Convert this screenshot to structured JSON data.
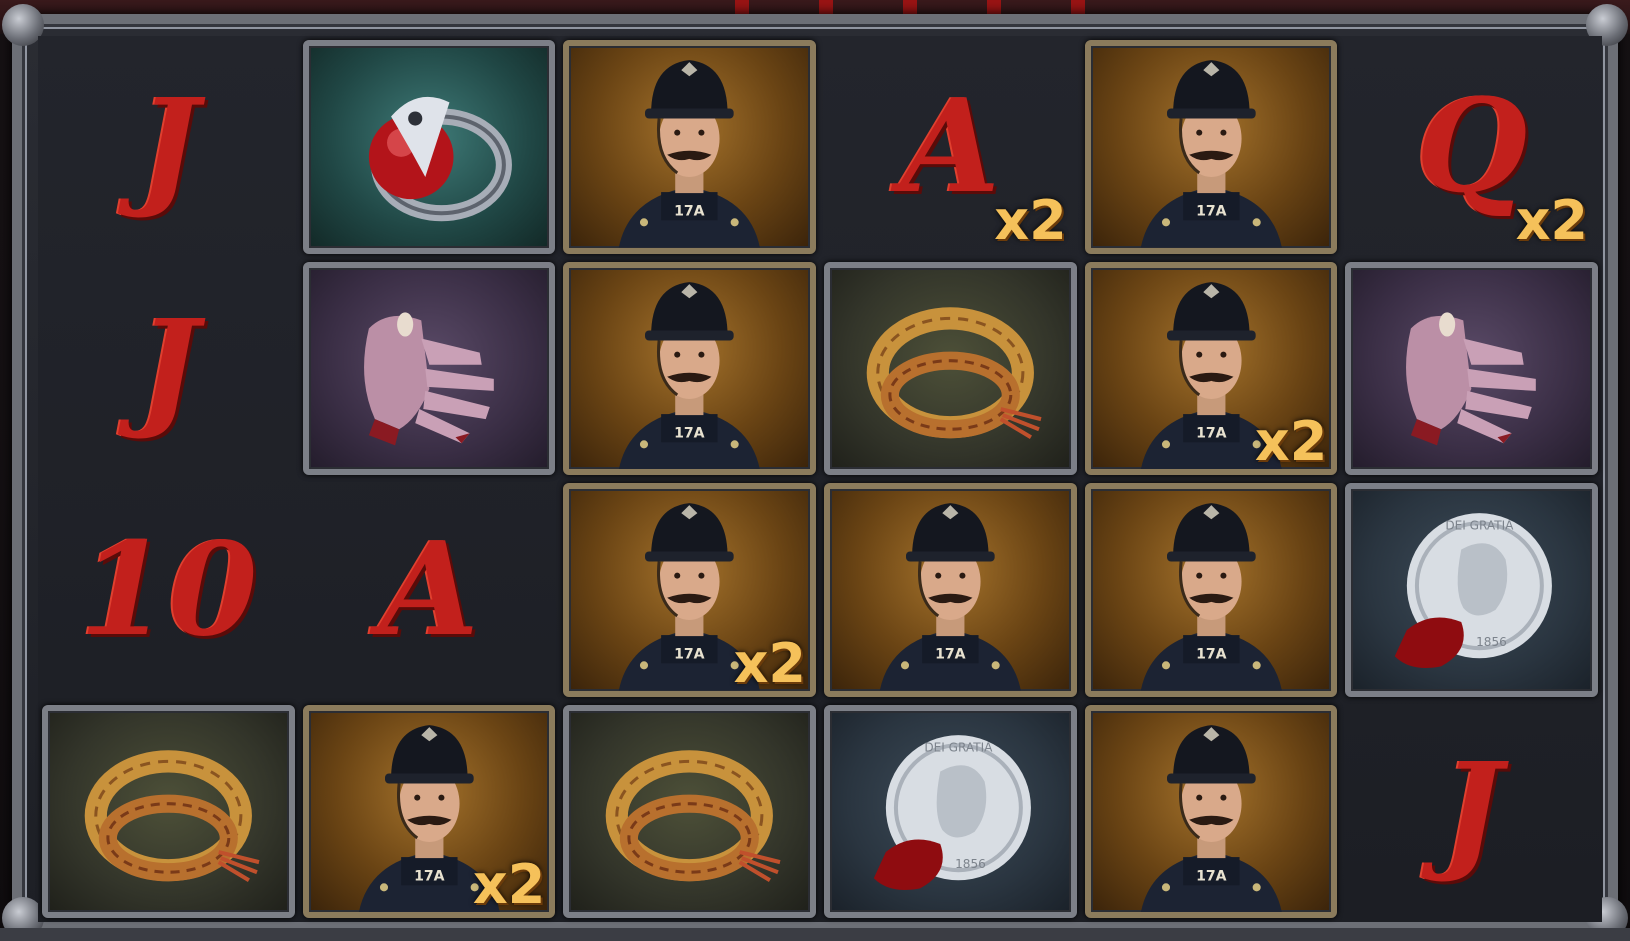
{
  "game": {
    "grid": [
      [
        {
          "type": "card",
          "label": "J"
        },
        {
          "type": "ring"
        },
        {
          "type": "officer"
        },
        {
          "type": "card",
          "label": "A",
          "multiplier": "x2"
        },
        {
          "type": "officer"
        },
        {
          "type": "card",
          "label": "Q",
          "multiplier": "x2"
        }
      ],
      [
        {
          "type": "card",
          "label": "J"
        },
        {
          "type": "gloves"
        },
        {
          "type": "officer"
        },
        {
          "type": "rope"
        },
        {
          "type": "officer",
          "multiplier": "x2"
        },
        {
          "type": "gloves"
        }
      ],
      [
        {
          "type": "card",
          "label": "10"
        },
        {
          "type": "card",
          "label": "A"
        },
        {
          "type": "officer",
          "multiplier": "x2"
        },
        {
          "type": "officer"
        },
        {
          "type": "officer"
        },
        {
          "type": "coin"
        }
      ],
      [
        {
          "type": "rope"
        },
        {
          "type": "officer",
          "multiplier": "x2"
        },
        {
          "type": "rope"
        },
        {
          "type": "coin"
        },
        {
          "type": "officer"
        },
        {
          "type": "card",
          "label": "J"
        }
      ]
    ]
  },
  "colors": {
    "blood_red": "#c2201c",
    "multiplier_gold": "#f5c15a",
    "frame_silver": "#7c7f87",
    "officer_tile_gold": "#a4722b"
  },
  "icons": {
    "ring": "skull-ring-icon",
    "gloves": "bloody-gloves-icon",
    "rope": "rope-icon",
    "coin": "victorian-coin-icon",
    "officer": "police-officer-icon"
  }
}
